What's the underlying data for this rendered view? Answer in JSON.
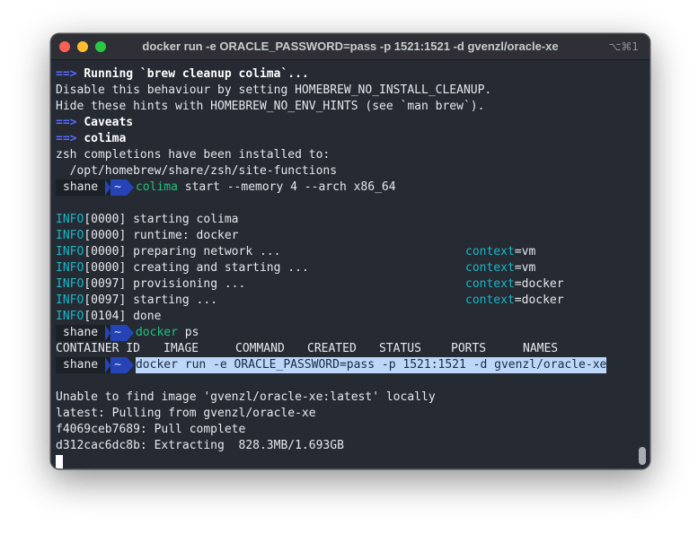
{
  "window": {
    "title": "docker run -e ORACLE_PASSWORD=pass -p 1521:1521 -d gvenzl/oracle-xe",
    "shortcut": "⌥⌘1"
  },
  "prompt": {
    "user": "shane",
    "dir": "~"
  },
  "lines": {
    "l1_arrow": "==>",
    "l1_text": "Running `brew cleanup colima`...",
    "l2": "Disable this behaviour by setting HOMEBREW_NO_INSTALL_CLEANUP.",
    "l3": "Hide these hints with HOMEBREW_NO_ENV_HINTS (see `man brew`).",
    "l4_arrow": "==>",
    "l4_text": "Caveats",
    "l5_arrow": "==>",
    "l5_text": "colima",
    "l6": "zsh completions have been installed to:",
    "l7": "  /opt/homebrew/share/zsh/site-functions",
    "cmd1_prog": "colima",
    "cmd1_args": " start --memory 4 --arch x86_64",
    "log": [
      {
        "level": "INFO",
        "rest": "[0000] starting colima",
        "ctx_key": "",
        "ctx_val": ""
      },
      {
        "level": "INFO",
        "rest": "[0000] runtime: docker",
        "ctx_key": "",
        "ctx_val": ""
      },
      {
        "level": "INFO",
        "rest": "[0000] preparing network ...",
        "ctx_key": "context",
        "ctx_val": "=vm"
      },
      {
        "level": "INFO",
        "rest": "[0000] creating and starting ...",
        "ctx_key": "context",
        "ctx_val": "=vm"
      },
      {
        "level": "INFO",
        "rest": "[0097] provisioning ...",
        "ctx_key": "context",
        "ctx_val": "=docker"
      },
      {
        "level": "INFO",
        "rest": "[0097] starting ...",
        "ctx_key": "context",
        "ctx_val": "=docker"
      },
      {
        "level": "INFO",
        "rest": "[0104] done",
        "ctx_key": "",
        "ctx_val": ""
      }
    ],
    "cmd2_prog": "docker",
    "cmd2_args": " ps",
    "ps_headers": [
      "CONTAINER ID",
      "IMAGE",
      "COMMAND",
      "CREATED",
      "STATUS",
      "PORTS",
      "NAMES"
    ],
    "cmd3": "docker run -e ORACLE_PASSWORD=pass -p 1521:1521 -d gvenzl/oracle-xe",
    "out1": "Unable to find image 'gvenzl/oracle-xe:latest' locally",
    "out2": "latest: Pulling from gvenzl/oracle-xe",
    "out3": "f4069ceb7689: Pull complete",
    "out4": "d312cac6dc8b: Extracting  828.3MB/1.693GB"
  }
}
